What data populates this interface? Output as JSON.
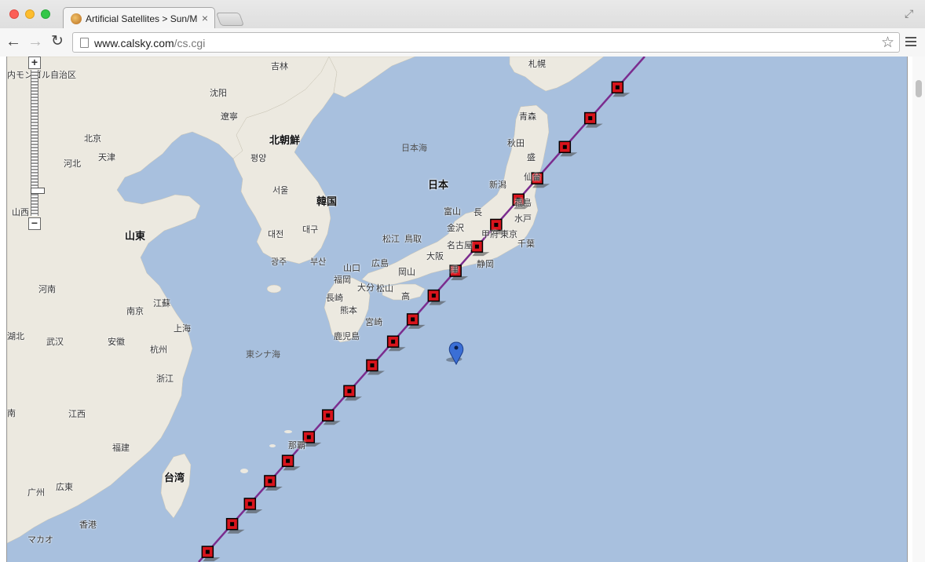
{
  "browser": {
    "tab_title": "Artificial Satellites > Sun/Moon",
    "tab_close": "×",
    "url_host": "www.calsky.com",
    "url_path": "/cs.cgi"
  },
  "map": {
    "zoom_in": "+",
    "zoom_out": "−",
    "labels": {
      "inner_mongolia": "内モンゴル自治区",
      "jilin": "吉林",
      "sapporo": "札幌",
      "shenyang": "沈阳",
      "liaoning": "遼寧",
      "aomori": "青森",
      "akita": "秋田",
      "beijing": "北京",
      "north_korea": "北朝鮮",
      "sea_of_japan": "日本海",
      "tianjin": "天津",
      "hebei": "河北",
      "pyongyang": "평양",
      "sendai": "仙台",
      "morioka": "盛",
      "japan": "日本",
      "niigata": "新潟",
      "seoul": "서울",
      "south_korea": "韓国",
      "shanxi": "山西",
      "toyama": "富山",
      "nagano": "長",
      "fukushima": "福島",
      "mito": "水戸",
      "kanazawa": "金沢",
      "shandong": "山東",
      "daejeon": "대전",
      "daegu": "대구",
      "matsue": "松江",
      "tottori": "鳥取",
      "kofu": "甲府",
      "tokyo": "東京",
      "chiba": "千葉",
      "gwangju": "광주",
      "busan": "부산",
      "osaka": "大阪",
      "nagoya": "名古屋",
      "yamaguchi": "山口",
      "hiroshima": "広島",
      "shizuoka": "静岡",
      "tsu": "津",
      "fukuoka": "福岡",
      "okayama": "岡山",
      "henan": "河南",
      "oita": "大分",
      "matsuyama": "松山",
      "kochi": "高",
      "nagasaki": "長崎",
      "jiangsu": "江蘇",
      "kumamoto": "熊本",
      "nanjing": "南京",
      "miyazaki": "宮崎",
      "shanghai": "上海",
      "kagoshima": "鹿児島",
      "hubei": "湖北",
      "wuhan": "武汉",
      "anhui": "安徽",
      "hangzhou": "杭州",
      "east_china_sea": "東シナ海",
      "zhejiang": "浙江",
      "hunan": "南",
      "jiangxi": "江西",
      "fujian": "福建",
      "naha": "那覇",
      "taiwan": "台湾",
      "guangzhou": "广州",
      "guangdong": "広東",
      "hong_kong": "香港",
      "macau": "マカオ"
    }
  },
  "colors": {
    "sea": "#a8c0de",
    "land": "#ece9e0",
    "track": "#7b2c8e",
    "marker_fill": "#d8141c",
    "pin": "#3b6fd6"
  },
  "icons": {
    "back": "arrow-left-icon",
    "forward": "arrow-right-icon",
    "reload": "reload-icon",
    "star": "star-icon",
    "menu": "hamburger-menu-icon",
    "pin": "map-pin-icon"
  }
}
